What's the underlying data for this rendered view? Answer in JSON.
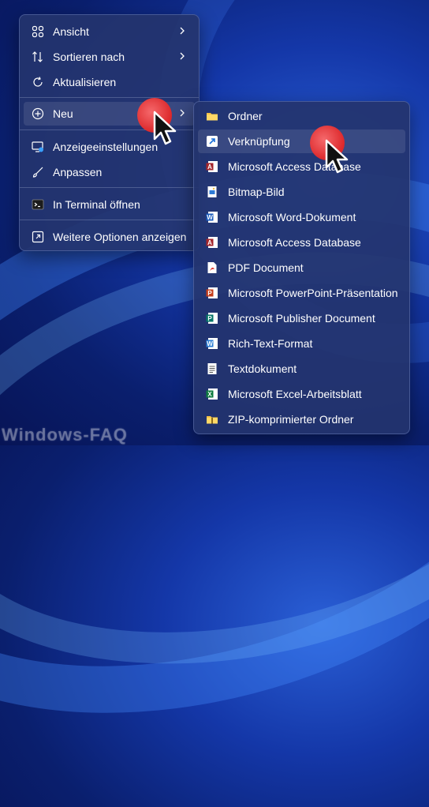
{
  "context_menu": {
    "items": [
      {
        "label": "Ansicht",
        "icon": "grid-icon",
        "has_submenu": true
      },
      {
        "label": "Sortieren nach",
        "icon": "sort-icon",
        "has_submenu": true
      },
      {
        "label": "Aktualisieren",
        "icon": "refresh-icon",
        "has_submenu": false
      },
      {
        "label": "Neu",
        "icon": "add-circle-icon",
        "has_submenu": true
      },
      {
        "label": "Anzeigeeinstellungen",
        "icon": "display-settings-icon",
        "has_submenu": false
      },
      {
        "label": "Anpassen",
        "icon": "brush-icon",
        "has_submenu": false
      },
      {
        "label": "In Terminal öffnen",
        "icon": "terminal-icon",
        "has_submenu": false
      },
      {
        "label": "Weitere Optionen anzeigen",
        "icon": "more-options-icon",
        "has_submenu": false
      }
    ]
  },
  "new_submenu": {
    "items": [
      {
        "label": "Ordner",
        "icon": "folder-icon"
      },
      {
        "label": "Verknüpfung",
        "icon": "shortcut-icon"
      },
      {
        "label": "Microsoft Access Database",
        "icon": "access-icon"
      },
      {
        "label": "Bitmap-Bild",
        "icon": "bitmap-icon"
      },
      {
        "label": "Microsoft Word-Dokument",
        "icon": "word-icon"
      },
      {
        "label": "Microsoft Access Database",
        "icon": "access-icon"
      },
      {
        "label": "PDF Document",
        "icon": "pdf-icon"
      },
      {
        "label": "Microsoft PowerPoint-Präsentation",
        "icon": "powerpoint-icon"
      },
      {
        "label": "Microsoft Publisher Document",
        "icon": "publisher-icon"
      },
      {
        "label": "Rich-Text-Format",
        "icon": "wordpad-icon"
      },
      {
        "label": "Textdokument",
        "icon": "text-document-icon"
      },
      {
        "label": "Microsoft Excel-Arbeitsblatt",
        "icon": "excel-icon"
      },
      {
        "label": "ZIP-komprimierter Ordner",
        "icon": "zip-folder-icon"
      }
    ]
  },
  "watermark": "Windows-FAQ",
  "colors": {
    "menu_bg": "#24346e",
    "accent_red": "#e52626",
    "text": "#ffffff"
  }
}
